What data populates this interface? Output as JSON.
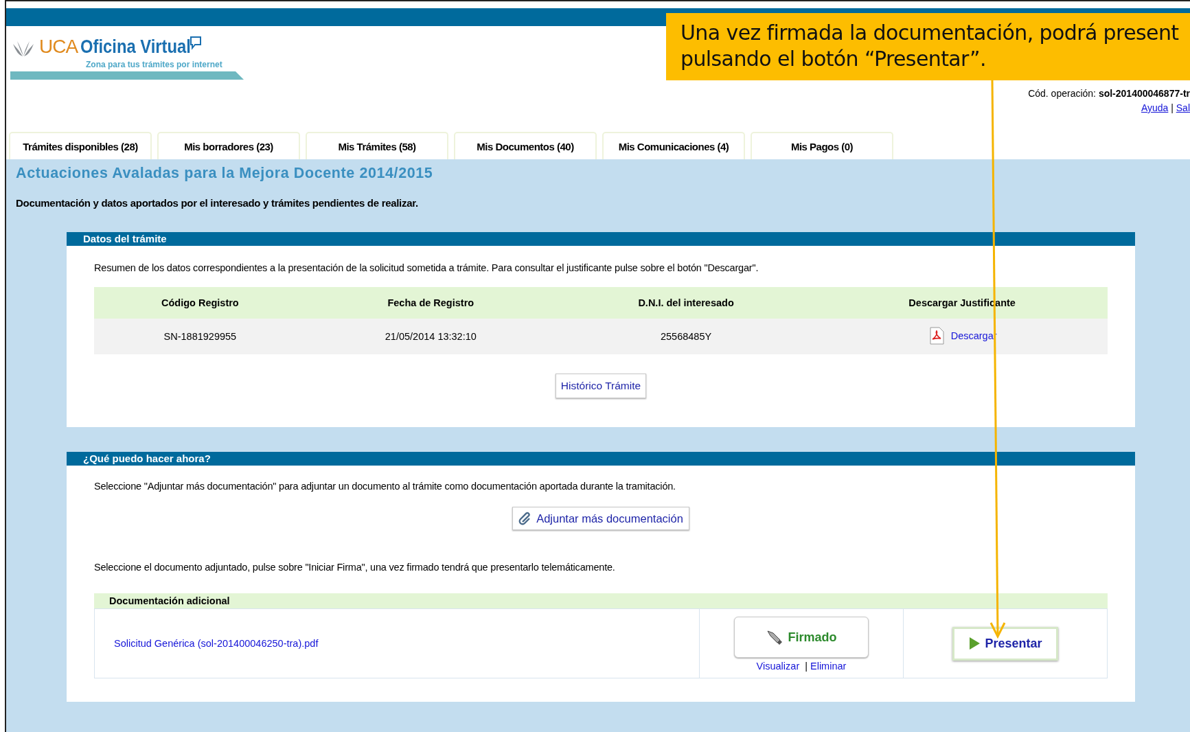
{
  "header": {
    "logo_brand": "UCA",
    "logo_title": "Oficina Virtual",
    "logo_tagline": "Zona para tus trámites por internet",
    "operation_label": "Cód. operación:",
    "operation_code": "sol-201400046877-tr",
    "links": [
      "Ayuda",
      "Sal"
    ],
    "separator": "|"
  },
  "tabs": [
    {
      "label": "Trámites disponibles (28)",
      "selected": false
    },
    {
      "label": "Mis borradores (23)",
      "selected": false
    },
    {
      "label": "Mis Trámites (58)",
      "selected": false
    },
    {
      "label": "Mis Documentos (40)",
      "selected": false
    },
    {
      "label": "Mis Comunicaciones (4)",
      "selected": false
    },
    {
      "label": "Mis Pagos (0)",
      "selected": false
    }
  ],
  "page_title": "Actuaciones Avaladas para la Mejora Docente 2014/2015",
  "page_subtitle": "Documentación y datos aportados por el interesado y trámites pendientes de realizar.",
  "procedure_panel": {
    "title": "Datos del trámite",
    "intro": "Resumen de los datos correspondientes a la presentación de la solicitud sometida a trámite. Para consultar el justificante pulse sobre el botón \"Descargar\".",
    "columns": [
      "Código Registro",
      "Fecha de Registro",
      "D.N.I. del interesado",
      "Descargar Justificante"
    ],
    "rows": [
      {
        "code": "SN-1881929955",
        "date": "21/05/2014 13:32:10",
        "dni": "25568485Y",
        "download": "Descargar"
      }
    ],
    "button": "Histórico Trámite"
  },
  "actions_panel": {
    "title": "¿Qué puedo hacer ahora?",
    "intro": "Seleccione \"Adjuntar más documentación\" para adjuntar un documento al trámite como documentación aportada durante la tramitación.",
    "attach_button": "Adjuntar más documentación",
    "sign_intro": "Seleccione el documento adjuntado, pulse sobre \"Iniciar Firma\", una vez firmado tendrá que presentarlo telemáticamente.",
    "documents_heading": "Documentación adicional",
    "documents": [
      {
        "file": "Solicitud Genérica (sol-201400046250-tra).pdf",
        "signed": true,
        "status": "Firmado",
        "links": [
          "Visualizar",
          "Eliminar"
        ],
        "separator": "|",
        "submit": "Presentar"
      }
    ]
  },
  "callout": {
    "lines": [
      "Una vez firmada la documentación, podrá present",
      "pulsando el botón “Presentar”."
    ]
  }
}
